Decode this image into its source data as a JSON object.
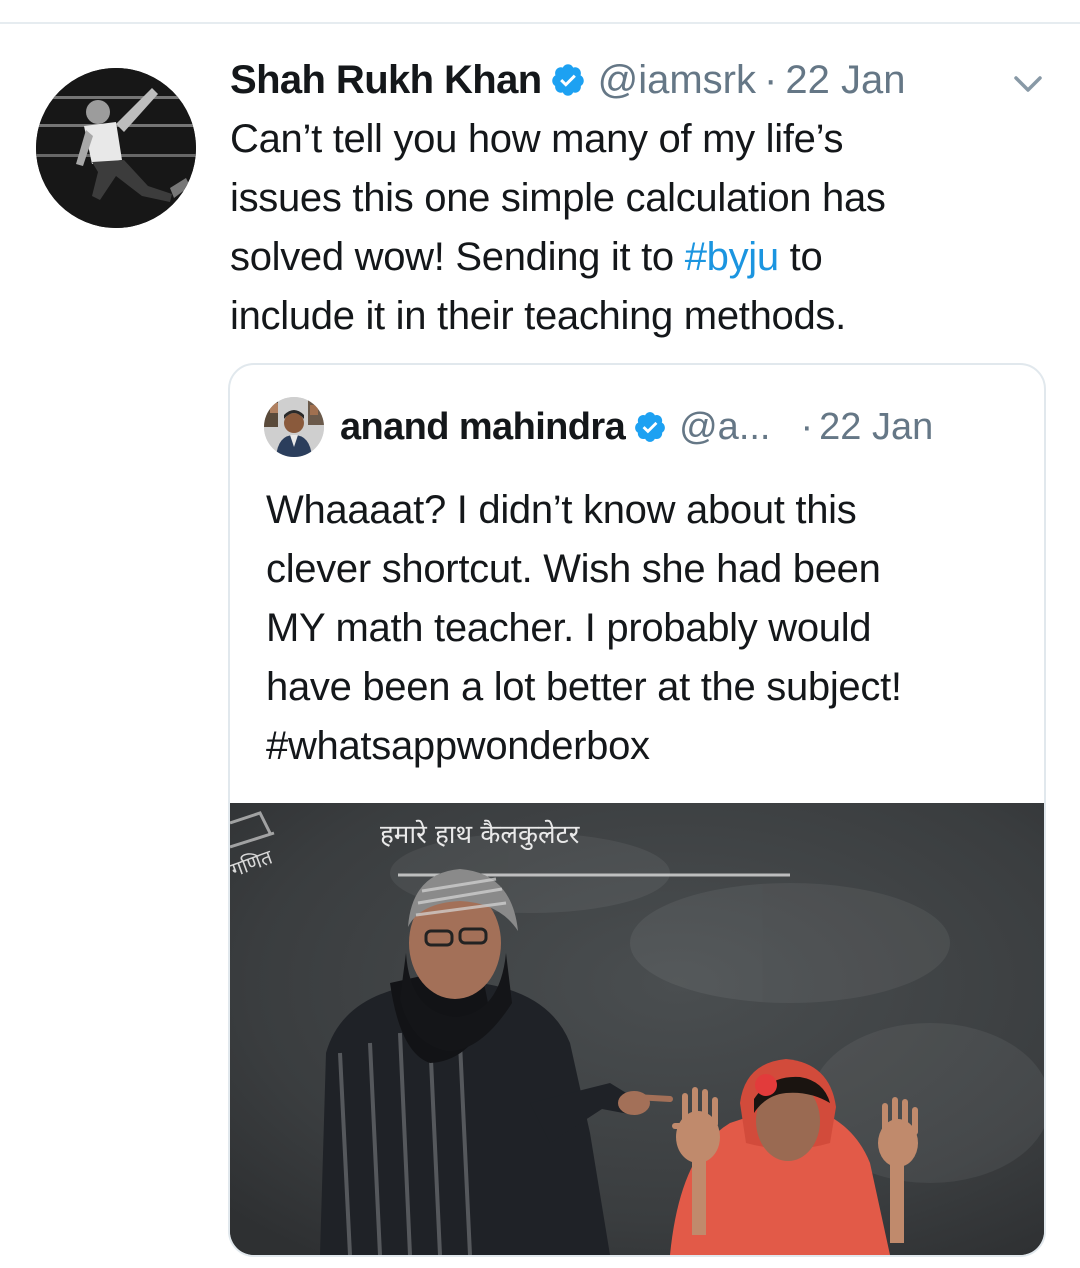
{
  "tweet": {
    "author_name": "Shah Rukh Khan",
    "handle": "@iamsrk",
    "separator": "·",
    "date": "22 Jan",
    "verified_icon": "verified-badge-icon",
    "menu_icon": "chevron-down-icon",
    "text_lines": [
      {
        "text": "Can’t tell you how many of my life’s"
      },
      {
        "text": "issues this one simple calculation has"
      },
      {
        "before": "solved wow! Sending it to ",
        "hashtag": "#byju",
        "after": " to"
      },
      {
        "text": "include it in their teaching methods."
      }
    ],
    "colors": {
      "text": "#14171a",
      "secondary": "#657786",
      "link": "#1b95e0",
      "verified": "#1da1f2",
      "border": "#e1e8ed"
    }
  },
  "quoted_tweet": {
    "author_name": "anand mahindra",
    "handle": "@a...",
    "separator": "·",
    "date": "22 Jan",
    "text_lines": [
      "Whaaaat? I didn’t know about this",
      "clever shortcut. Wish she had been",
      "MY math teacher. I probably would",
      "have been a lot better at the subject!",
      "#whatsappwonderbox"
    ],
    "media": {
      "chalkboard_text": "हमारे हाथ कैलकुलेटर",
      "side_text": "गणित"
    }
  }
}
